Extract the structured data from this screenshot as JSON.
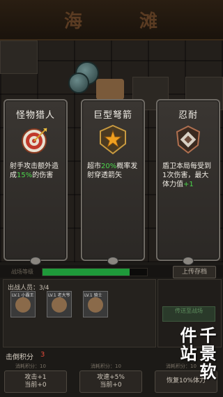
{
  "title": {
    "char1": "海",
    "char2": "滩"
  },
  "cards": [
    {
      "title": "怪物猎人",
      "icon": "target-icon",
      "desc_pre": "射手攻击额外造成",
      "highlight": "15%",
      "desc_post": "的伤害"
    },
    {
      "title": "巨型弩箭",
      "icon": "star-shield-icon",
      "desc_pre": "超市",
      "highlight": "20%",
      "desc_post": "概率发射穿透箭矢"
    },
    {
      "title": "忍耐",
      "icon": "shield-rune-icon",
      "desc_pre": "盾卫本局每受到1次伤害，最大体力值",
      "highlight": "+1",
      "desc_post": ""
    }
  ],
  "status": {
    "label": "战场等级",
    "progress": 0.83,
    "upload": "上传存档"
  },
  "party": {
    "label": "出战人员：3/4",
    "members": [
      "LV.1 小霸王",
      "LV.1 老大爷",
      "LV.1 骑士"
    ]
  },
  "side": {
    "button": "传送至战场"
  },
  "score": {
    "label": "击倒积分",
    "value": "3"
  },
  "actions": [
    {
      "cost": "消耗积分：10",
      "label": "攻击+1",
      "sub": "当前+0"
    },
    {
      "cost": "消耗积分：10",
      "label": "攻速+5%",
      "sub": "当前+0"
    },
    {
      "cost": "消耗积分：10",
      "label": "恢复10%体力",
      "sub": ""
    }
  ],
  "watermark": "千景软件站",
  "colors": {
    "accent_green": "#1f9a3a",
    "highlight_green": "#4cd64c",
    "score_red": "#e04a3a"
  }
}
